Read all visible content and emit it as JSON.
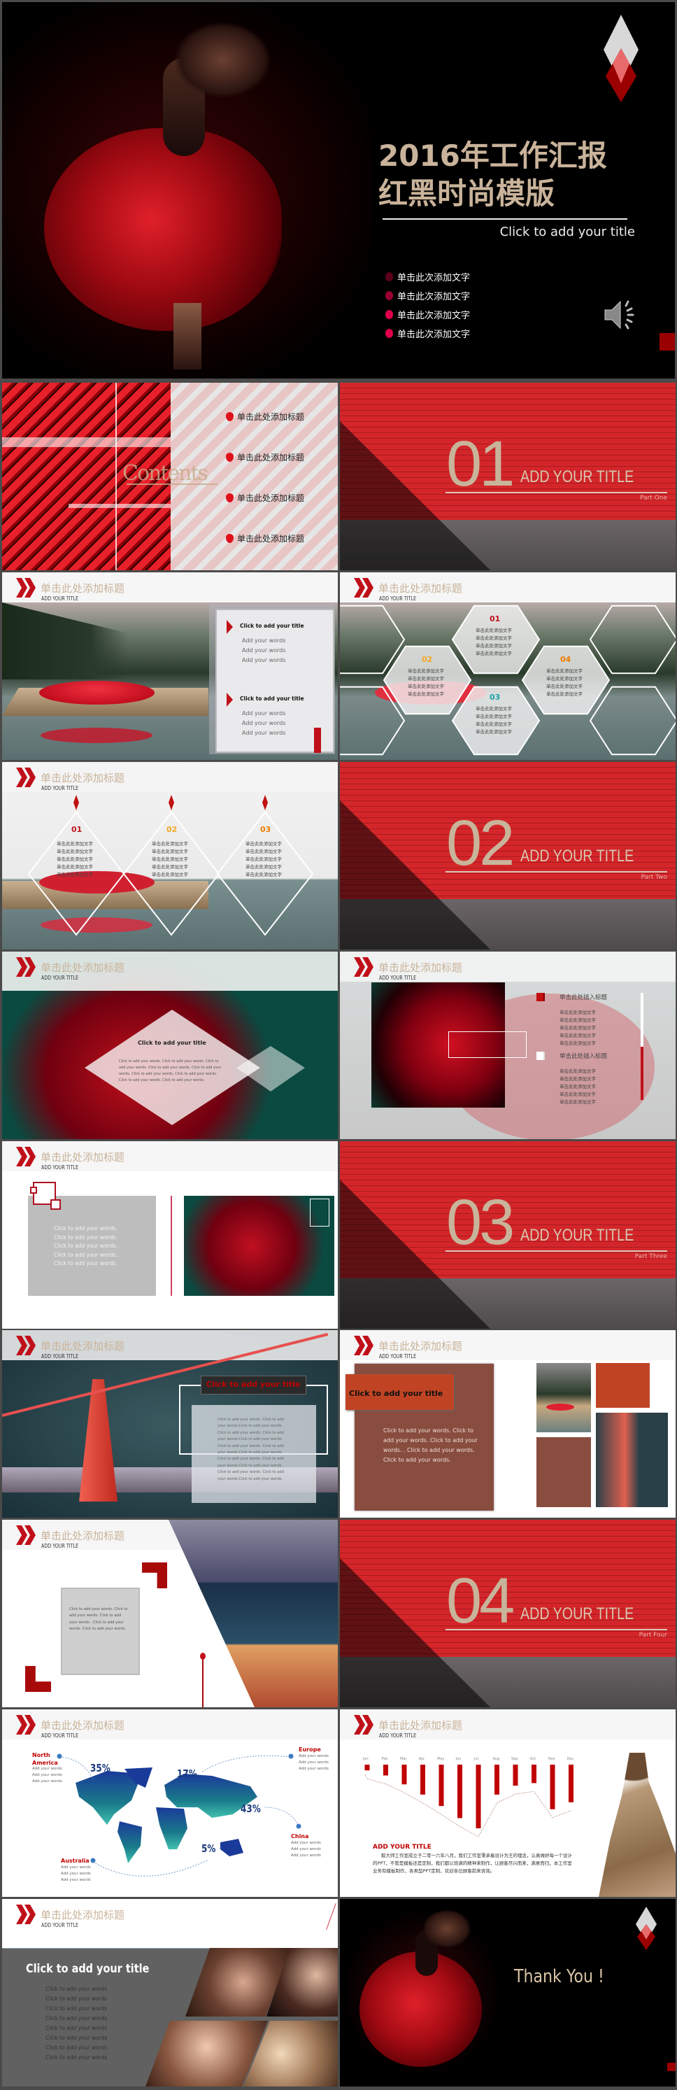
{
  "header": {
    "title_cn": "单击此处添加标题",
    "title_en": "ADD YOUR TITLE"
  },
  "cover": {
    "title_line1": "2016年工作汇报",
    "title_line2": "红黑时尚模版",
    "subtitle": "Click to add your title",
    "bullets": [
      "单击此次添加文字",
      "单击此次添加文字",
      "单击此次添加文字",
      "单击此次添加文字"
    ],
    "bullet_colors": [
      "#5a0018",
      "#9a0030",
      "#e0004a",
      "#e0004a"
    ],
    "audio_icon": "speaker-icon"
  },
  "contents": {
    "label": "Contents",
    "items": [
      "单击此处添加标题",
      "单击此处添加标题",
      "单击此处添加标题",
      "单击此处添加标题"
    ]
  },
  "sections": [
    {
      "number": "01",
      "title": "ADD YOUR TITLE",
      "part": "Part One"
    },
    {
      "number": "02",
      "title": "ADD YOUR TITLE",
      "part": "Part Two"
    },
    {
      "number": "03",
      "title": "ADD YOUR TITLE",
      "part": "Part Three"
    },
    {
      "number": "04",
      "title": "ADD YOUR TITLE",
      "part": "Part Four"
    }
  ],
  "lake_panel": {
    "blocks": [
      {
        "title": "Click to add your title",
        "lines": [
          "Add your words",
          "Add your words",
          "Add your words"
        ]
      },
      {
        "title": "Click to add your title",
        "lines": [
          "Add your words",
          "Add your words",
          "Add your words"
        ]
      }
    ]
  },
  "hexagons": [
    {
      "number": "01",
      "color": "#c0101a",
      "lines": [
        "单击此处添加文字",
        "单击此处添加文字",
        "单击此处添加文字",
        "单击此处添加文字"
      ]
    },
    {
      "number": "02",
      "color": "#f5a623",
      "lines": [
        "单击此处添加文字",
        "单击此处添加文字",
        "单击此处添加文字",
        "单击此处添加文字"
      ]
    },
    {
      "number": "03",
      "color": "#1aa3a8",
      "lines": [
        "单击此处添加文字",
        "单击此处添加文字",
        "单击此处添加文字",
        "单击此处添加文字"
      ]
    },
    {
      "number": "04",
      "color": "#f07c00",
      "lines": [
        "单击此处添加文字",
        "单击此处添加文字",
        "单击此处添加文字",
        "单击此处添加文字"
      ]
    }
  ],
  "diamonds": [
    {
      "number": "01",
      "color": "#c0101a",
      "lines": [
        "单击此处添加文字",
        "单击此处添加文字",
        "单击此处添加文字",
        "单击此处添加文字",
        "单击此处添加文字"
      ]
    },
    {
      "number": "02",
      "color": "#f5a623",
      "lines": [
        "单击此处添加文字",
        "单击此处添加文字",
        "单击此处添加文字",
        "单击此处添加文字",
        "单击此处添加文字"
      ]
    },
    {
      "number": "03",
      "color": "#f07c00",
      "lines": [
        "单击此处添加文字",
        "单击此处添加文字",
        "单击此处添加文字",
        "单击此处添加文字",
        "单击此处添加文字"
      ]
    }
  ],
  "rose_diamond": {
    "title": "Click to add your title",
    "lines": [
      "Click to add your words. Click to add your words. Click to",
      "add your words. Click to add your words. Click to add your",
      "words. Click to add your words.  Click to add your words.",
      "Click to add your words. Click to add your words."
    ]
  },
  "rose_list": {
    "blocks": [
      {
        "title": "单击此处插入标题",
        "lines": [
          "单击此处添加文字",
          "单击此处添加文字",
          "单击此处添加文字",
          "单击此处添加文字",
          "单击此处添加文字"
        ]
      },
      {
        "title": "单击此处插入标题",
        "lines": [
          "单击此处添加文字",
          "单击此处添加文字",
          "单击此处添加文字",
          "单击此处添加文字",
          "单击此处添加文字"
        ]
      }
    ],
    "progress": 0.5
  },
  "gray_box": {
    "lines": [
      "Click to add your words.",
      "Click to add your words.",
      "Click to add your words. .",
      "Click to add your words..",
      "Click to add your words."
    ]
  },
  "bridge": {
    "title": "Click to add your title",
    "lines": [
      "Click to add your words. Click to add",
      "your words.Click to add your words.",
      "Click to add your words. Click to add",
      "your words.Click to add your words.",
      "Click to add your words. Click to add",
      "your words.Click to add your words.",
      "Click to add your words. Click to add",
      "your words.Click to add your words.",
      "Click to add your words. Click to add",
      "your words.Click to add your words."
    ]
  },
  "brown_panel": {
    "title": "Click to add your title",
    "lines": [
      "Click to add your words. Click to",
      "add your words.  Click to add your",
      "words. .  Click to add your words.",
      "Click to add your words."
    ]
  },
  "city": {
    "lines": [
      "Click to add your words. Click to",
      "add your words.   Click to add",
      "your words .   Click to add your",
      "words.   Click to add your words."
    ]
  },
  "map": {
    "regions": [
      {
        "name": "North America",
        "lines": [
          "Add your words",
          "Add your words",
          "Add your words"
        ]
      },
      {
        "name": "Europe",
        "lines": [
          "Add your words",
          "Add your words",
          "Add your words"
        ]
      },
      {
        "name": "China",
        "lines": [
          "Add your words",
          "Add your words",
          "Add your words"
        ]
      },
      {
        "name": "Australia",
        "lines": [
          "Add your words",
          "Add your words",
          "Add your words"
        ]
      }
    ],
    "percents": [
      "35%",
      "17%",
      "43%",
      "5%"
    ]
  },
  "chart_data": {
    "type": "bar",
    "categories": [
      "Jan",
      "Feb",
      "Mar",
      "Apr",
      "May",
      "Jun",
      "Jul",
      "Aug",
      "Sep",
      "Oct",
      "Nov",
      "Dec"
    ],
    "values": [
      9,
      17,
      31,
      47,
      65,
      84,
      100,
      47,
      33,
      29,
      70,
      59
    ],
    "ylim": [
      0,
      100
    ],
    "orientation": "hanging-down",
    "bar_color": "#c00000",
    "grid": false
  },
  "chart_text": {
    "title": "ADD YOUR TITLE",
    "paragraph": "毅大师工作室成立于二零一六年八月，我们工作室秉承着设计为王的理念，认真做好每一个设计的PPT，不管是模板还是定制，我们都以饱满的精神来制作，让顾客尽兴而来，满意而归，本工作室业务有模板制作，各类型PPT定制，欢迎各位顾客前来咨询。"
  },
  "portrait": {
    "title": "Click to add your title",
    "lines": [
      "Click to add your words",
      "Click to add your words",
      "Click to add your words",
      "Click to add your words",
      "Click to add your words",
      "Click to add your words",
      "Click to add your words",
      "Click to add your words"
    ]
  },
  "thanks": {
    "text": "Thank You !"
  },
  "colors": {
    "accent": "#c0101a",
    "gold": "#c9b39a",
    "dark": "#000000"
  }
}
